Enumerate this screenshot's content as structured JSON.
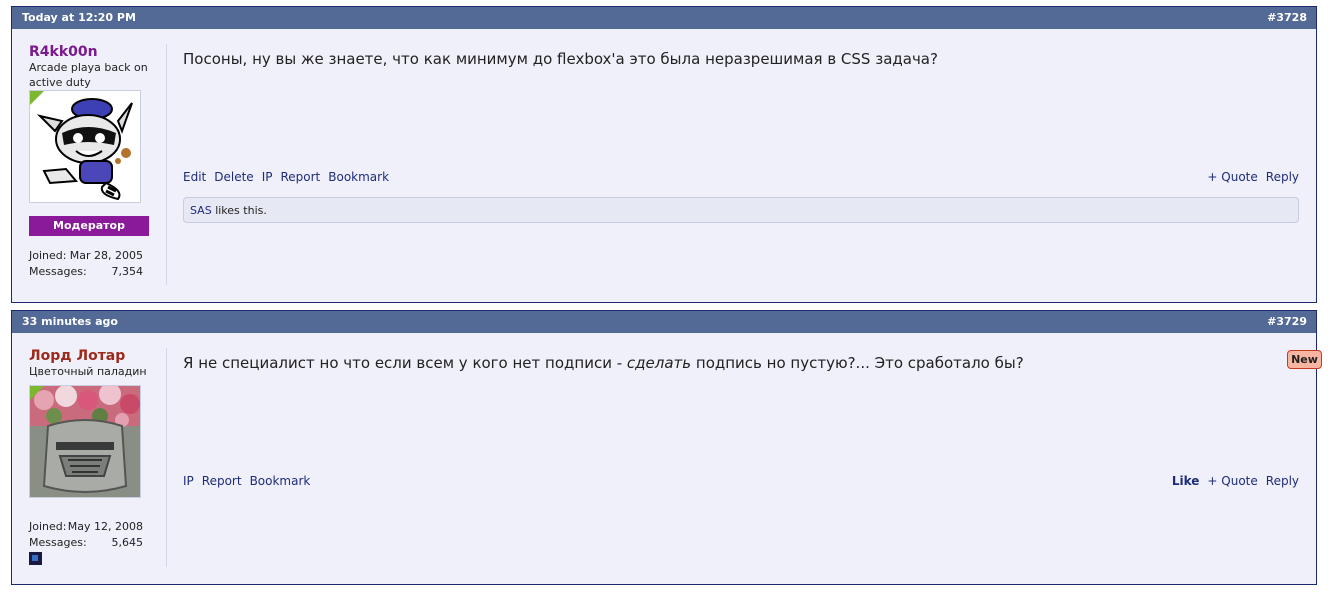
{
  "posts": [
    {
      "time": "Today at 12:20 PM",
      "number": "#3728",
      "username": "R4kk00n",
      "username_color": "#7a1a8c",
      "usertitle": "Arcade playa back on active duty",
      "avatar_icon": "raccoon-icon",
      "rank": "Модератор",
      "joined_label": "Joined:",
      "joined": "Mar 28, 2005",
      "messages_label": "Messages:",
      "messages": "7,354",
      "message": "Посоны, ну вы же знаете, что как минимум до flexbox'а это была неразрешимая в CSS задача?",
      "links": [
        "Edit",
        "Delete",
        "IP",
        "Report",
        "Bookmark"
      ],
      "quote": "+ Quote",
      "reply": "Reply",
      "liker": "SAS",
      "likes_suffix": " likes this."
    },
    {
      "time": "33 minutes ago",
      "number": "#3729",
      "username": "Лорд Лотар",
      "username_color": "#9c2a1a",
      "usertitle": "Цветочный паладин",
      "avatar_icon": "knight-helmet-with-flowers-icon",
      "joined_label": "Joined:",
      "joined": "May 12, 2008",
      "messages_label": "Messages:",
      "messages": "5,645",
      "message_before": "Я не специалист но что если всем у кого нет подписи - ",
      "message_em": "сделать",
      "message_after": " подпись но пустую?... Это сработало бы?",
      "links": [
        "IP",
        "Report",
        "Bookmark"
      ],
      "like": "Like",
      "quote": "+ Quote",
      "reply": "Reply",
      "new_badge": "New"
    }
  ]
}
